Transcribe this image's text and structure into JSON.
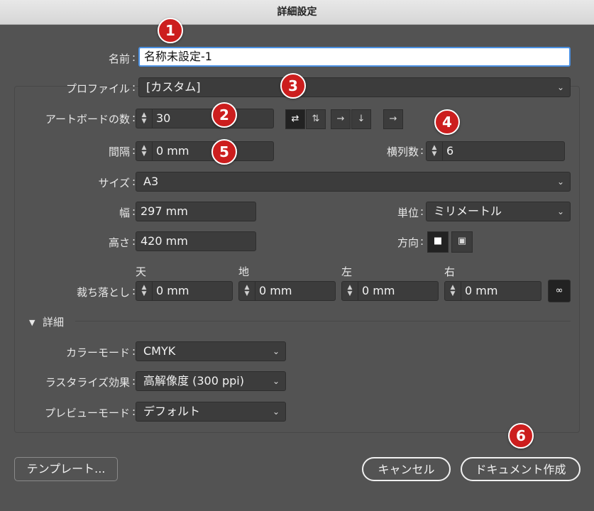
{
  "window": {
    "title": "詳細設定"
  },
  "name": {
    "label": "名前",
    "value": "名称未設定-1"
  },
  "profile": {
    "label": "プロファイル",
    "value": "[カスタム]"
  },
  "artboards": {
    "label": "アートボードの数",
    "value": "30"
  },
  "spacing": {
    "label": "間隔",
    "value": "0 mm"
  },
  "columns": {
    "label": "横列数",
    "value": "6"
  },
  "size": {
    "label": "サイズ",
    "value": "A3"
  },
  "width": {
    "label": "幅",
    "value": "297 mm"
  },
  "units": {
    "label": "単位",
    "value": "ミリメートル"
  },
  "height": {
    "label": "高さ",
    "value": "420 mm"
  },
  "orientation": {
    "label": "方向"
  },
  "bleed": {
    "label": "裁ち落とし",
    "top_label": "天",
    "top": "0 mm",
    "bottom_label": "地",
    "bottom": "0 mm",
    "left_label": "左",
    "left": "0 mm",
    "right_label": "右",
    "right": "0 mm"
  },
  "advanced": {
    "label": "詳細",
    "color_mode": {
      "label": "カラーモード",
      "value": "CMYK"
    },
    "raster": {
      "label": "ラスタライズ効果",
      "value": "高解像度 (300 ppi)"
    },
    "preview": {
      "label": "プレビューモード",
      "value": "デフォルト"
    }
  },
  "buttons": {
    "templates": "テンプレート...",
    "cancel": "キャンセル",
    "create": "ドキュメント作成"
  },
  "badges": [
    "1",
    "2",
    "3",
    "4",
    "5",
    "6"
  ],
  "colors": {
    "accent": "#4a90e2",
    "badge": "#cc1e1e",
    "background": "#535353"
  },
  "icons": [
    "grid-by-row-icon",
    "grid-by-column-icon",
    "arrange-by-row-icon",
    "arrange-by-column-icon",
    "right-to-left-icon",
    "portrait-icon",
    "landscape-icon",
    "link-icon",
    "chevron-down-icon",
    "stepper-icon"
  ]
}
